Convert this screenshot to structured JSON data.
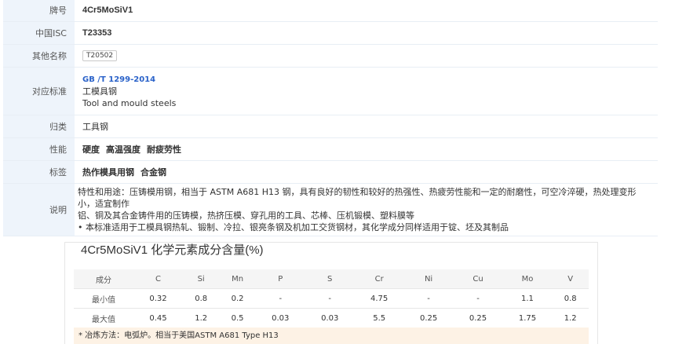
{
  "info": {
    "grade": {
      "label": "牌号",
      "value": "4Cr5MoSiV1"
    },
    "isc": {
      "label": "中国ISC",
      "value": "T23353"
    },
    "other_names": {
      "label": "其他名称",
      "tags": [
        "T20502"
      ]
    },
    "standard": {
      "label": "对应标准",
      "link": "GB /T 1299-2014",
      "cn": "工模具钢",
      "en": "Tool and mould steels"
    },
    "category": {
      "label": "归类",
      "value": "工具钢"
    },
    "properties": {
      "label": "性能",
      "items": [
        "硬度",
        "高温强度",
        "耐疲劳性"
      ]
    },
    "tags": {
      "label": "标签",
      "items": [
        "热作模具用钢",
        "合金钢"
      ]
    },
    "description": {
      "label": "说明",
      "line1": "特性和用途：压铸模用钢，相当于 ASTM A681 H13 钢，具有良好的韧性和较好的热强性、热疲劳性能和一定的耐磨性，可空冷淬硬，热处理变形小，适宜制作",
      "line2": "铝、铜及其合金铸件用的压铸模，热挤压模、穿孔用的工具、芯棒、压机锻模、塑料膜等",
      "line3": "• 本标准适用于工模具钢热轧、锻制、冷拉、银亮条钢及机加工交货钢材，其化学成分同样适用于锭、坯及其制品"
    }
  },
  "composition": {
    "title": "4Cr5MoSiV1 化学元素成分含量(%)",
    "header": [
      "成分",
      "C",
      "Si",
      "Mn",
      "P",
      "S",
      "Cr",
      "Ni",
      "Cu",
      "Mo",
      "V"
    ],
    "rows": [
      [
        "最小值",
        "0.32",
        "0.8",
        "0.2",
        "-",
        "-",
        "4.75",
        "-",
        "-",
        "1.1",
        "0.8"
      ],
      [
        "最大值",
        "0.45",
        "1.2",
        "0.5",
        "0.03",
        "0.03",
        "5.5",
        "0.25",
        "0.25",
        "1.75",
        "1.2"
      ]
    ],
    "note": "* 冶炼方法：电弧炉。相当于美国ASTM A681 Type H13"
  }
}
